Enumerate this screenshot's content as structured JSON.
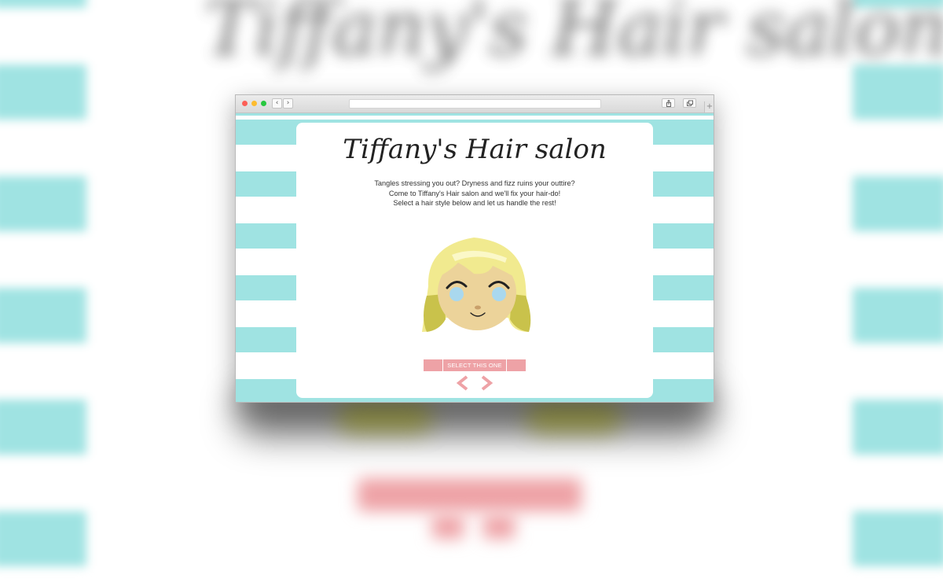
{
  "backdrop": {
    "title": "Tiffany's Hair salon"
  },
  "browser": {
    "controls": {
      "back_glyph": "‹",
      "forward_glyph": "›",
      "new_tab_glyph": "+"
    },
    "icons": [
      "close-dot",
      "minimize-dot",
      "zoom-dot",
      "share-icon",
      "tabs-icon"
    ]
  },
  "page": {
    "title": "Tiffany's Hair salon",
    "tagline": [
      "Tangles stressing you out? Dryness and fizz ruins your outtire?",
      "Come to Tiffany's Hair salon and we'll fix your hair-do!",
      "Select a hair style below and let us handle the rest!"
    ],
    "select_button_label": "SELECT THIS ONE",
    "prev_arrow": "previous-style",
    "next_arrow": "next-style"
  },
  "colors": {
    "stripe": "#9fe3e2",
    "button": "#eea2a6",
    "hair": "#f1ea8f",
    "hair_shadow": "#c9c24b",
    "skin": "#ecd39a",
    "eyes": "#a9d8ee"
  }
}
